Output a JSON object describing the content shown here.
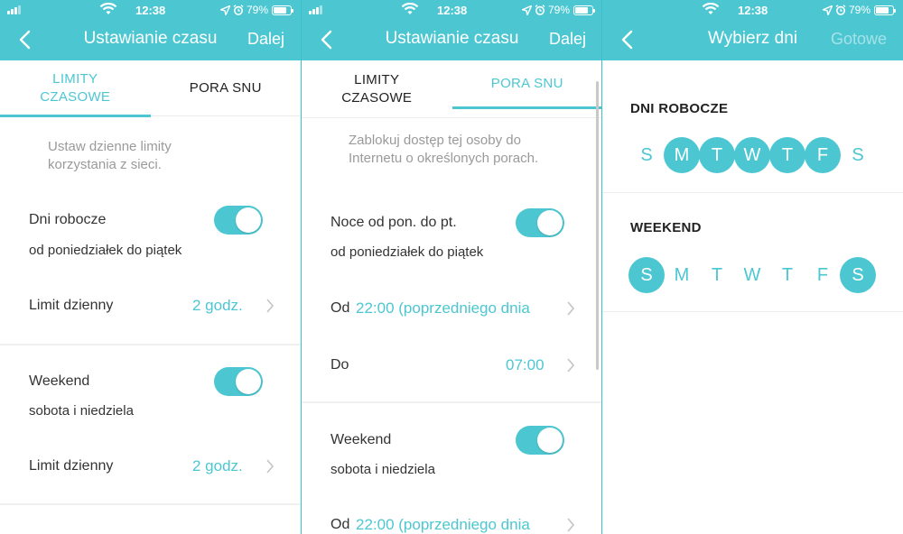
{
  "status": {
    "time": "12:38",
    "battery": "79%"
  },
  "screen1": {
    "title": "Ustawianie czasu",
    "next": "Dalej",
    "tab_limits": "LIMITY\nCZASOWE",
    "tab_sleep": "PORA SNU",
    "description": "Ustaw dzienne limity korzystania z sieci.",
    "weekdays": {
      "label": "Dni robocze",
      "sub": "od poniedziałek do piątek",
      "limit_label": "Limit dzienny",
      "limit_value": "2 godz."
    },
    "weekend": {
      "label": "Weekend",
      "sub": "sobota i niedziela",
      "limit_label": "Limit dzienny",
      "limit_value": "2 godz."
    }
  },
  "screen2": {
    "title": "Ustawianie czasu",
    "next": "Dalej",
    "tab_limits": "LIMITY\nCZASOWE",
    "tab_sleep": "PORA SNU",
    "description": "Zablokuj dostęp tej osoby do Internetu o określonych porach.",
    "nights": {
      "label": "Noce od pon. do pt.",
      "sub": "od poniedziałek do piątek",
      "from_label": "Od",
      "from_value": "22:00 (poprzedniego dnia",
      "to_label": "Do",
      "to_value": "07:00"
    },
    "weekend": {
      "label": "Weekend",
      "sub": "sobota i niedziela",
      "from_label": "Od",
      "from_value": "22:00 (poprzedniego dnia"
    }
  },
  "screen3": {
    "title": "Wybierz dni",
    "done": "Gotowe",
    "workdays_title": "DNI ROBOCZE",
    "weekend_title": "WEEKEND",
    "workdays": [
      {
        "l": "S",
        "on": false
      },
      {
        "l": "M",
        "on": true
      },
      {
        "l": "T",
        "on": true
      },
      {
        "l": "W",
        "on": true
      },
      {
        "l": "T",
        "on": true
      },
      {
        "l": "F",
        "on": true
      },
      {
        "l": "S",
        "on": false
      }
    ],
    "weekend_days": [
      {
        "l": "S",
        "on": true
      },
      {
        "l": "M",
        "on": false
      },
      {
        "l": "T",
        "on": false
      },
      {
        "l": "W",
        "on": false
      },
      {
        "l": "T",
        "on": false
      },
      {
        "l": "F",
        "on": false
      },
      {
        "l": "S",
        "on": true
      }
    ]
  },
  "colors": {
    "accent": "#4cc7d2",
    "muted": "#9a9a9a"
  }
}
